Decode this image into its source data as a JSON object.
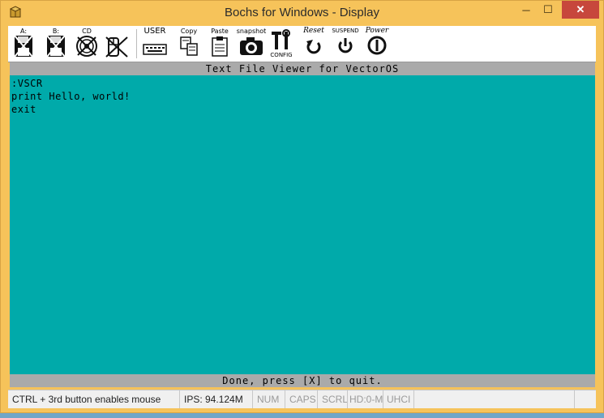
{
  "window": {
    "title": "Bochs for Windows - Display",
    "controls": {
      "minimize": "─",
      "maximize": "☐",
      "close": "✕"
    }
  },
  "toolbar": {
    "floppy_a": {
      "label": "A:",
      "icon": "floppy-icon"
    },
    "floppy_b": {
      "label": "B:",
      "icon": "floppy-icon"
    },
    "cdrom": {
      "label": "CD",
      "icon": "cdrom-icon"
    },
    "mouse": {
      "label": "",
      "icon": "mouse-icon"
    },
    "user": {
      "label": "USER",
      "icon": "keyboard-icon"
    },
    "copy": {
      "label": "Copy",
      "icon": "copy-icon"
    },
    "paste": {
      "label": "Paste",
      "icon": "paste-icon"
    },
    "snapshot": {
      "label": "snapshot",
      "icon": "camera-icon"
    },
    "config": {
      "label": "CONFIG",
      "icon": "config-icon"
    },
    "reset": {
      "label": "Reset",
      "icon": "reset-icon"
    },
    "suspend": {
      "label": "SUSPEND",
      "icon": "suspend-icon"
    },
    "power": {
      "label": "Power",
      "icon": "power-icon"
    }
  },
  "screen": {
    "header": "Text File Viewer for VectorOS",
    "lines": [
      ":VSCR",
      "print Hello, world!",
      "exit"
    ],
    "footer": "Done, press [X] to quit.",
    "colors": {
      "background": "#00aaaa",
      "bar": "#aaaaaa",
      "text": "#000000"
    }
  },
  "status": {
    "mouse_hint": "CTRL + 3rd button enables mouse",
    "ips": "IPS: 94.124M",
    "num": "NUM",
    "caps": "CAPS",
    "scrl": "SCRL",
    "hd": "HD:0-M",
    "uhci": "UHCI"
  }
}
